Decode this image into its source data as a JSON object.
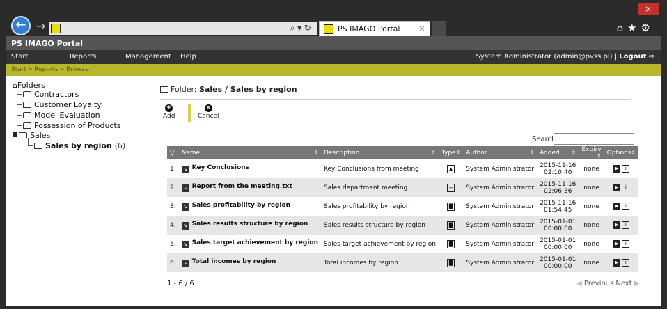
{
  "browser": {
    "tab_title": "PS IMAGO Portal",
    "close_glyph": "×",
    "back_icon": "back-arrow-icon",
    "forward_icon": "forward-arrow-icon",
    "toolbar_icons": "home-icon star-icon gear-icon",
    "search_icons": "⌕ ▾ ↻"
  },
  "app": {
    "title": "PS IMAGO Portal",
    "menu": [
      "Start",
      "Reports",
      "Management",
      "Help"
    ],
    "user": "System Administrator (admin@pvss.pl) | ",
    "logout": "Logout",
    "breadcrumb": "Start » Reports » Browse"
  },
  "tree": {
    "root": "Folders",
    "items": [
      "Contractors",
      "Customer Loyalty",
      "Model Evaluation",
      "Possession of Products",
      "Sales"
    ],
    "child_label": "Sales by region",
    "child_count": "(6)"
  },
  "folder": {
    "prefix": "Folder: ",
    "path": "Sales / Sales by region"
  },
  "toolbar": {
    "add_label": "Add",
    "cancel_label": "Cancel"
  },
  "search": {
    "label": "Search:",
    "value": ""
  },
  "table": {
    "headers": [
      "Name",
      "Description",
      "Type",
      "Author",
      "Added",
      "Expiry",
      "Options"
    ],
    "rows": [
      {
        "num": "1.",
        "name": "Key Conclusions",
        "description": "Key Conclusions from meeting",
        "type": "image",
        "author": "System Administrator",
        "added_date": "2015-11-16",
        "added_time": "02:10:40",
        "expiry": "none"
      },
      {
        "num": "2.",
        "name": "Report from the meeting.txt",
        "description": "Sales department meeting",
        "type": "text",
        "author": "System Administrator",
        "added_date": "2015-11-16",
        "added_time": "02:06:36",
        "expiry": "none"
      },
      {
        "num": "3.",
        "name": "Sales profitability by region",
        "description": "Sales profitability by region",
        "type": "chart",
        "author": "System Administrator",
        "added_date": "2015-11-16",
        "added_time": "01:54:45",
        "expiry": "none"
      },
      {
        "num": "4.",
        "name": "Sales results structure by region",
        "description": "Sales results structure by region",
        "type": "chart",
        "author": "System Administrator",
        "added_date": "2015-01-01",
        "added_time": "00:00:00",
        "expiry": "none"
      },
      {
        "num": "5.",
        "name": "Sales target achievement by region",
        "description": "Sales target achievement by region",
        "type": "chart",
        "author": "System Administrator",
        "added_date": "2015-01-01",
        "added_time": "00:00:00",
        "expiry": "none"
      },
      {
        "num": "6.",
        "name": "Total incomes by region",
        "description": "Total incomes by region",
        "type": "chart",
        "author": "System Administrator",
        "added_date": "2015-01-01",
        "added_time": "00:00:00",
        "expiry": "none"
      }
    ]
  },
  "footer": {
    "count": "1 - 6 / 6",
    "previous": "Previous",
    "next": "Next"
  },
  "colors": {
    "breadcrumb_bg": "#b8b82c",
    "header_bg": "#777777",
    "menubar_bg": "#333333",
    "titlebar_bg": "#555555",
    "back_button": "#2f7fd8"
  }
}
